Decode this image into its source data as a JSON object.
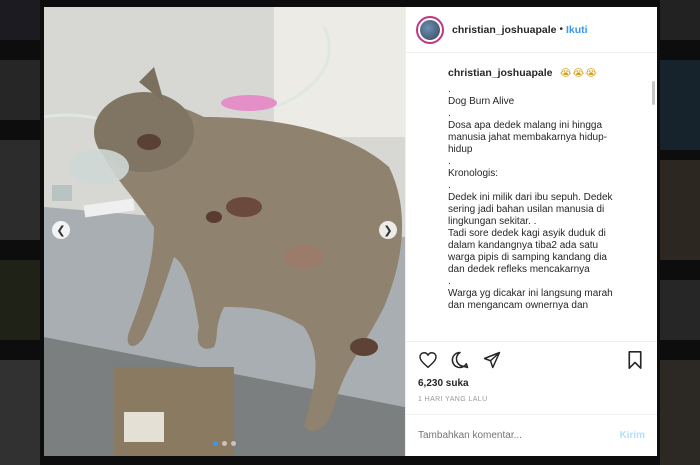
{
  "post": {
    "username": "christian_joshuapale",
    "separator": "•",
    "follow_label": "Ikuti",
    "caption_user": "christian_joshuapale",
    "caption_emoji": "😭😭😭",
    "caption_lines": [
      ".",
      "Dog Burn Alive",
      ".",
      "Dosa apa dedek malang ini hingga",
      "manusia jahat membakarnya hidup-",
      "hidup",
      ".",
      "Kronologis:",
      ".",
      "Dedek ini milik dari ibu sepuh. Dedek",
      "sering jadi bahan usilan manusia di",
      "lingkungan sekitar. .",
      "Tadi sore dedek kagi asyik duduk di",
      "dalam kandangnya tiba2 ada satu",
      "warga pipis di samping kandang dia",
      "dan dedek refleks mencakarnya",
      ".",
      "Warga yg dicakar ini langsung marah",
      "dan mengancam ownernya dan"
    ],
    "likes": "6,230 suka",
    "timestamp": "1 HARI YANG LALU",
    "comment_placeholder": "Tambahkan komentar...",
    "post_button": "Kirim",
    "carousel": {
      "count": 3,
      "active": 0
    }
  },
  "icons": {
    "prev": "chevron-left-icon",
    "next": "chevron-right-icon",
    "like": "heart-icon",
    "comment": "comment-bubble-icon",
    "share": "share-icon",
    "save": "bookmark-icon"
  },
  "colors": {
    "accent": "#3897f0",
    "post_button_disabled": "#b2dffc",
    "text": "#262626",
    "muted": "#999999"
  }
}
